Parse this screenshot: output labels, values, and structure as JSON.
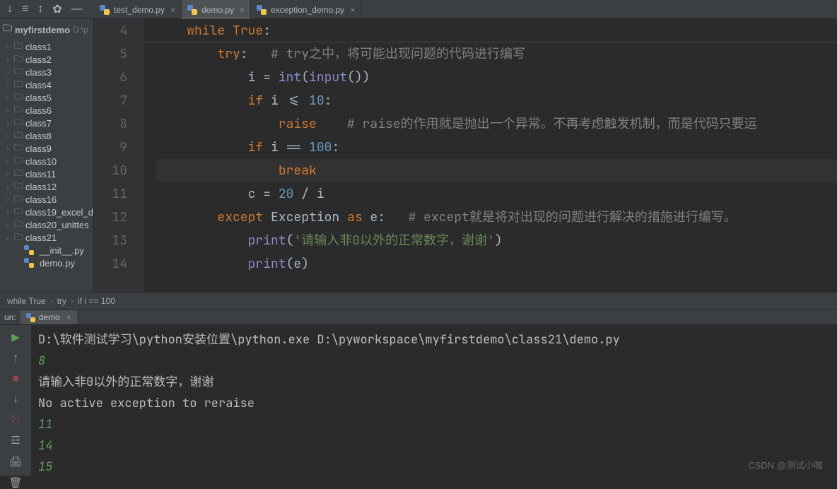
{
  "toolbar": {
    "icons": [
      "arrow-down-icon",
      "three-bars-icon",
      "collapse-icon",
      "gear-icon",
      "hide-icon"
    ]
  },
  "tabs": [
    {
      "label": "test_demo.py",
      "active": false
    },
    {
      "label": "demo.py",
      "active": true
    },
    {
      "label": "exception_demo.py",
      "active": false
    }
  ],
  "project": {
    "root": "myfirstdemo",
    "root_path": "D:\\p",
    "folders": [
      {
        "label": "class1",
        "expanded": false
      },
      {
        "label": "class2",
        "expanded": false
      },
      {
        "label": "class3",
        "expanded": false
      },
      {
        "label": "class4",
        "expanded": false
      },
      {
        "label": "class5",
        "expanded": false
      },
      {
        "label": "class6",
        "expanded": false
      },
      {
        "label": "class7",
        "expanded": false
      },
      {
        "label": "class8",
        "expanded": false
      },
      {
        "label": "class9",
        "expanded": false
      },
      {
        "label": "class10",
        "expanded": false
      },
      {
        "label": "class11",
        "expanded": false
      },
      {
        "label": "class12",
        "expanded": false
      },
      {
        "label": "class16",
        "expanded": false
      },
      {
        "label": "class19_excel_d",
        "expanded": false
      },
      {
        "label": "class20_unittes",
        "expanded": false
      },
      {
        "label": "class21",
        "expanded": true,
        "children": [
          {
            "label": "__init__.py"
          },
          {
            "label": "demo.py"
          }
        ]
      }
    ]
  },
  "editor": {
    "lines": {
      "4": {
        "indent": 1,
        "tokens": [
          {
            "t": "kw",
            "v": "while"
          },
          {
            "t": "sp",
            "v": " "
          },
          {
            "t": "kw",
            "v": "True"
          },
          {
            "t": "p",
            "v": ":"
          }
        ]
      },
      "5": {
        "indent": 2,
        "tokens": [
          {
            "t": "kw",
            "v": "try"
          },
          {
            "t": "p",
            "v": ":   "
          },
          {
            "t": "cmt",
            "v": "# try之中，将可能出现问题的代码进行编写"
          }
        ]
      },
      "6": {
        "indent": 3,
        "tokens": [
          {
            "t": "p",
            "v": "i = "
          },
          {
            "t": "builtin",
            "v": "int"
          },
          {
            "t": "p",
            "v": "("
          },
          {
            "t": "builtin",
            "v": "input"
          },
          {
            "t": "p",
            "v": "())"
          }
        ]
      },
      "7": {
        "indent": 3,
        "tokens": [
          {
            "t": "kw",
            "v": "if"
          },
          {
            "t": "p",
            "v": " i <= "
          },
          {
            "t": "num",
            "v": "10"
          },
          {
            "t": "p",
            "v": ":"
          }
        ]
      },
      "8": {
        "indent": 4,
        "tokens": [
          {
            "t": "kw",
            "v": "raise",
            "err": true
          },
          {
            "t": "p",
            "v": "    "
          },
          {
            "t": "cmt",
            "v": "# raise的作用就是抛出一个异常。不再考虑触发机制，而是代码只要运"
          }
        ]
      },
      "9": {
        "indent": 3,
        "tokens": [
          {
            "t": "kw",
            "v": "if"
          },
          {
            "t": "p",
            "v": " i == "
          },
          {
            "t": "num",
            "v": "100"
          },
          {
            "t": "p",
            "v": ":"
          }
        ]
      },
      "10": {
        "indent": 4,
        "caret": true,
        "tokens": [
          {
            "t": "kw",
            "v": "break"
          }
        ]
      },
      "11": {
        "indent": 3,
        "tokens": [
          {
            "t": "p",
            "v": "c = "
          },
          {
            "t": "num",
            "v": "20"
          },
          {
            "t": "p",
            "v": " / i"
          }
        ]
      },
      "12": {
        "indent": 2,
        "tokens": [
          {
            "t": "kw",
            "v": "except"
          },
          {
            "t": "p",
            "v": " Exception "
          },
          {
            "t": "kw",
            "v": "as"
          },
          {
            "t": "p",
            "v": " e:   "
          },
          {
            "t": "cmt",
            "v": "# except就是将对出现的问题进行解决的措施进行编写。"
          }
        ]
      },
      "13": {
        "indent": 3,
        "tokens": [
          {
            "t": "builtin",
            "v": "print"
          },
          {
            "t": "p",
            "v": "("
          },
          {
            "t": "str",
            "v": "'请输入非0以外的正常数字，谢谢'"
          },
          {
            "t": "p",
            "v": ")"
          }
        ]
      },
      "14": {
        "indent": 3,
        "tokens": [
          {
            "t": "builtin",
            "v": "print"
          },
          {
            "t": "p",
            "v": "(e)"
          }
        ]
      }
    },
    "line_order": [
      "4",
      "5",
      "6",
      "7",
      "8",
      "9",
      "10",
      "11",
      "12",
      "13",
      "14"
    ]
  },
  "breadcrumb": [
    "while True",
    "try",
    "if i == 100"
  ],
  "run": {
    "label": "un:",
    "tab": "demo",
    "console": [
      {
        "cls": "cmd",
        "text": "D:\\软件测试学习\\python安装位置\\python.exe D:\\pyworkspace\\myfirstdemo\\class21\\demo.py"
      },
      {
        "cls": "g",
        "text": "8"
      },
      {
        "cls": "cmd",
        "text": "请输入非0以外的正常数字，谢谢"
      },
      {
        "cls": "cmd",
        "text": "No active exception to reraise"
      },
      {
        "cls": "g",
        "text": "11"
      },
      {
        "cls": "g",
        "text": "14"
      },
      {
        "cls": "g",
        "text": "15"
      }
    ]
  },
  "watermark": "CSDN @测试小咖"
}
